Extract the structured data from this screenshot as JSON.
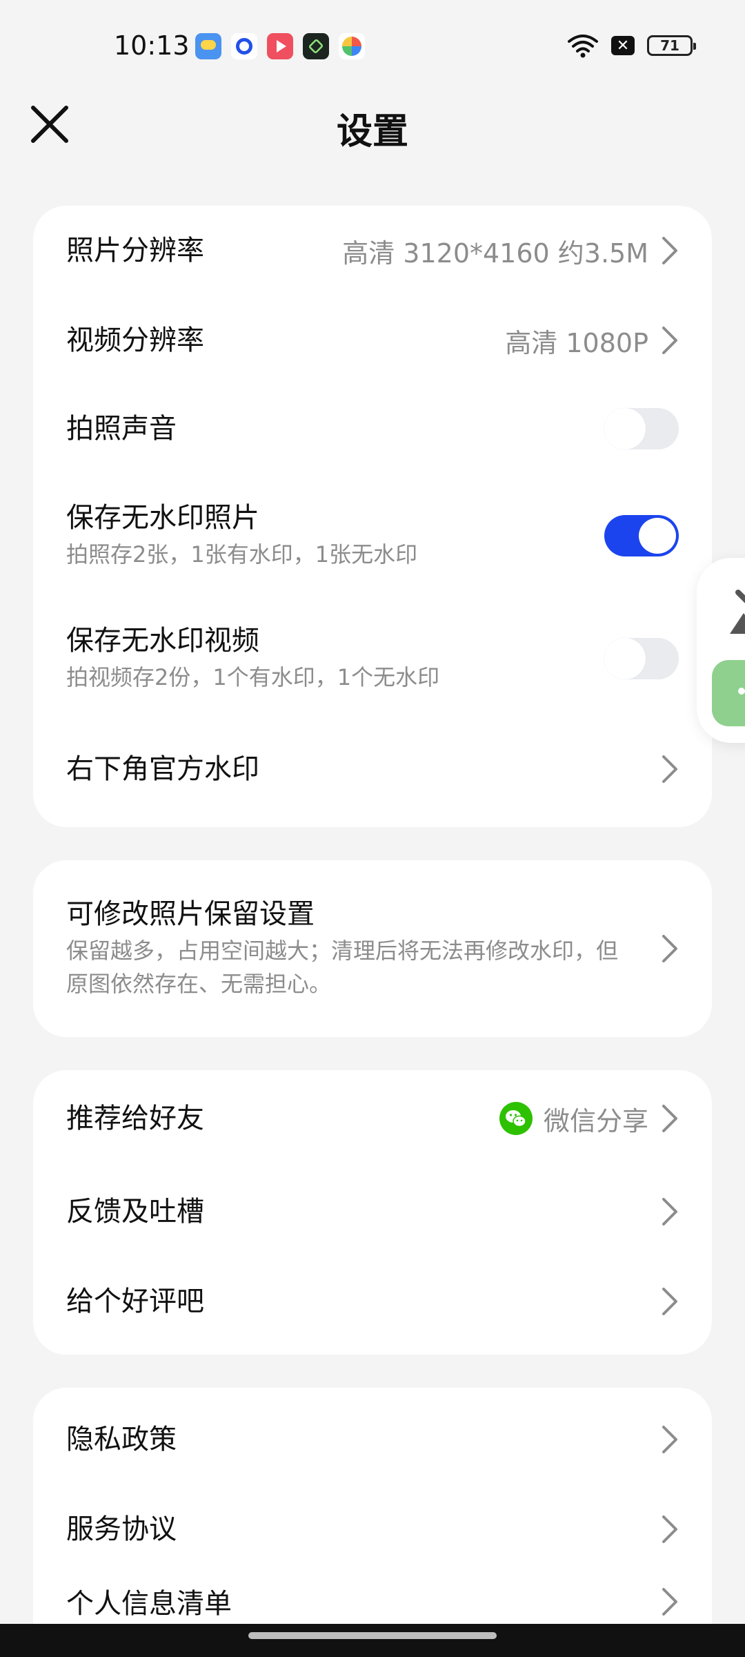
{
  "status_bar": {
    "time": "10:13",
    "battery": "71",
    "x_badge": "✕"
  },
  "header": {
    "title": "设置"
  },
  "card1": {
    "photo_resolution": {
      "label": "照片分辨率",
      "value": "高清 3120*4160  约3.5M"
    },
    "video_resolution": {
      "label": "视频分辨率",
      "value": "高清 1080P"
    },
    "shutter_sound": {
      "label": "拍照声音",
      "enabled": false
    },
    "save_no_watermark_photo": {
      "label": "保存无水印照片",
      "sub": "拍照存2张，1张有水印，1张无水印",
      "enabled": true
    },
    "save_no_watermark_video": {
      "label": "保存无水印视频",
      "sub": "拍视频存2份，1个有水印，1个无水印",
      "enabled": false
    },
    "official_watermark": {
      "label": "右下角官方水印"
    }
  },
  "card2": {
    "editable_photo_retention": {
      "label": "可修改照片保留设置",
      "sub": "保留越多，占用空间越大；清理后将无法再修改水印，但原图依然存在、无需担心。"
    }
  },
  "card3": {
    "recommend": {
      "label": "推荐给好友",
      "value": "微信分享"
    },
    "feedback": {
      "label": "反馈及吐槽"
    },
    "rate": {
      "label": "给个好评吧"
    }
  },
  "card4": {
    "privacy": {
      "label": "隐私政策"
    },
    "service": {
      "label": "服务协议"
    },
    "personal_info": {
      "label": "个人信息清单"
    }
  },
  "colors": {
    "accent": "#1c44ee",
    "wechat_green": "#2dc100",
    "background": "#f4f4f4"
  }
}
